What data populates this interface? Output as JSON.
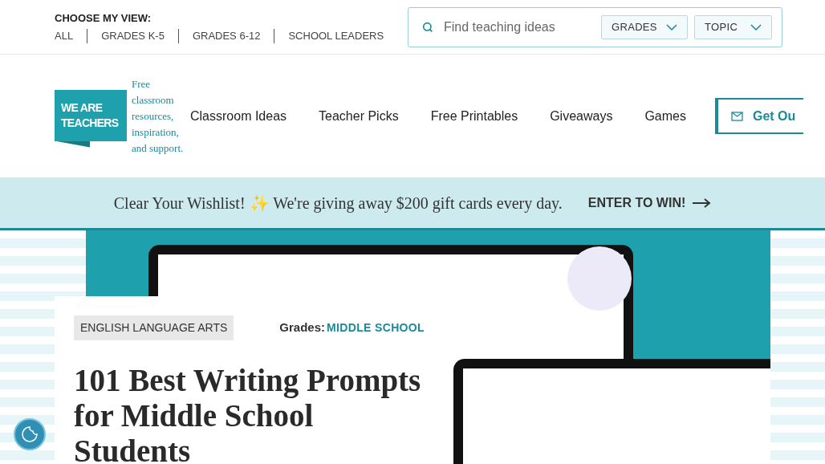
{
  "view_chooser": {
    "title": "CHOOSE MY VIEW:",
    "options": [
      {
        "label": "ALL",
        "selected": false
      },
      {
        "label": "GRADES K-5",
        "selected": false
      },
      {
        "label": "GRADES 6-12",
        "selected": false
      },
      {
        "label": "SCHOOL LEADERS",
        "selected": false
      }
    ]
  },
  "search": {
    "placeholder": "Find teaching ideas",
    "filters": [
      "GRADES",
      "TOPIC"
    ]
  },
  "logo": {
    "lines": [
      "WE ARE",
      "TEACHERS"
    ],
    "tagline": "Free classroom resources, inspiration, and support."
  },
  "nav": [
    "Classroom Ideas",
    "Teacher Picks",
    "Free Printables",
    "Giveaways",
    "Games"
  ],
  "cta": "Get Ou",
  "banner": {
    "text": "Clear Your Wishlist! ✨ We're giving away $200 gift cards every day.",
    "link": "ENTER TO WIN!"
  },
  "article": {
    "category": "ENGLISH LANGUAGE ARTS",
    "grades_label": "Grades:",
    "grades": "MIDDLE SCHOOL",
    "title": "101 Best Writing Prompts for Middle School Students"
  }
}
